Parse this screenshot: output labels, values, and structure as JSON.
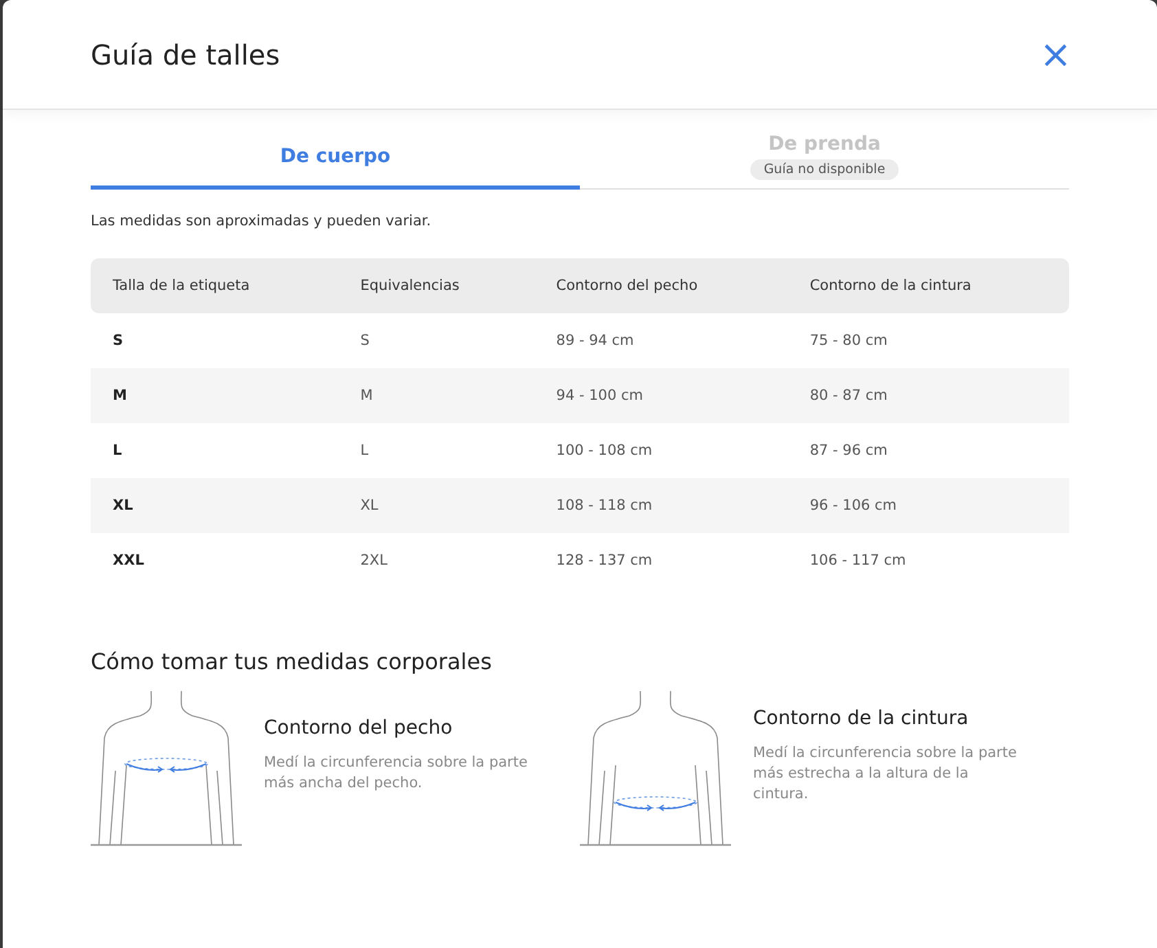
{
  "modal": {
    "title": "Guía de talles",
    "close": "×"
  },
  "tabs": [
    {
      "label": "De cuerpo",
      "selected": true,
      "disabled": false
    },
    {
      "label": "De prenda",
      "selected": false,
      "disabled": true,
      "badge": "Guía no disponible"
    }
  ],
  "note": "Las medidas son aproximadas y pueden variar.",
  "table": {
    "columns": [
      "Talla de la etiqueta",
      "Equivalencias",
      "Contorno del pecho",
      "Contorno de la cintura"
    ],
    "rows": [
      [
        "S",
        "S",
        "89 - 94 cm",
        "75 - 80 cm"
      ],
      [
        "M",
        "M",
        "94 - 100 cm",
        "80 - 87 cm"
      ],
      [
        "L",
        "L",
        "100 - 108 cm",
        "87 - 96 cm"
      ],
      [
        "XL",
        "XL",
        "108 - 118 cm",
        "96 - 106 cm"
      ],
      [
        "XXL",
        "2XL",
        "128 - 137 cm",
        "106 - 117 cm"
      ]
    ]
  },
  "guide": {
    "title": "Cómo tomar tus medidas corporales",
    "items": [
      {
        "kind": "chest",
        "title": "Contorno del pecho",
        "text": "Medí la circunferencia sobre la parte más ancha del pecho."
      },
      {
        "kind": "waist",
        "title": "Contorno de la cintura",
        "text": "Medí la circunferencia sobre la parte más estrecha a la altura de la cintura."
      }
    ]
  }
}
